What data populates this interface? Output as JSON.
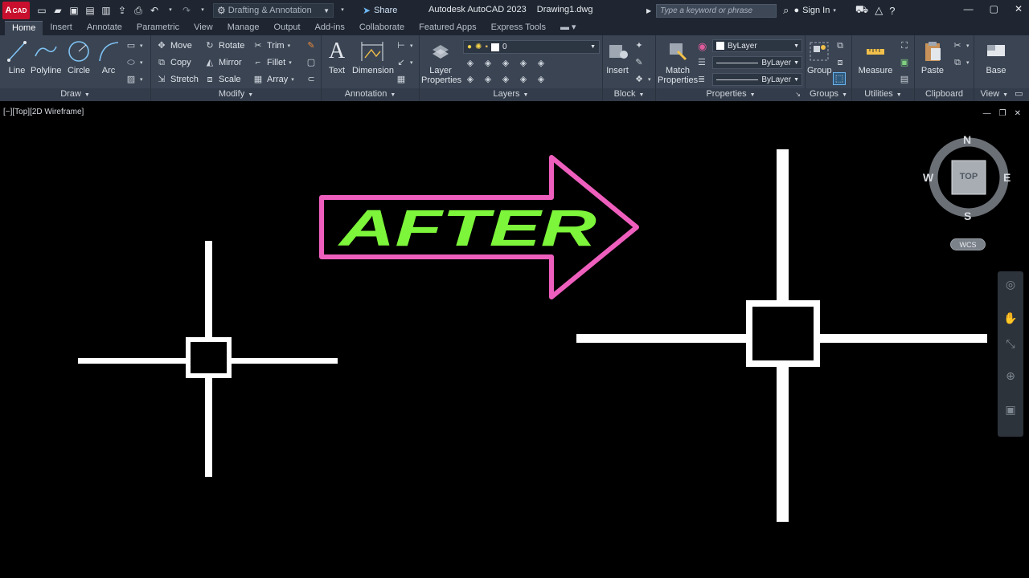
{
  "titlebar": {
    "app_button": "CAD",
    "app_letter": "A",
    "workspace": "Drafting & Annotation",
    "share": "Share",
    "app_name": "Autodesk AutoCAD 2023",
    "document": "Drawing1.dwg",
    "search_placeholder": "Type a keyword or phrase",
    "signin": "Sign In"
  },
  "tabs": [
    "Home",
    "Insert",
    "Annotate",
    "Parametric",
    "View",
    "Manage",
    "Output",
    "Add-ins",
    "Collaborate",
    "Featured Apps",
    "Express Tools"
  ],
  "ribbon": {
    "draw": {
      "title": "Draw",
      "line": "Line",
      "polyline": "Polyline",
      "circle": "Circle",
      "arc": "Arc"
    },
    "modify": {
      "title": "Modify",
      "move": "Move",
      "rotate": "Rotate",
      "trim": "Trim",
      "copy": "Copy",
      "mirror": "Mirror",
      "fillet": "Fillet",
      "stretch": "Stretch",
      "scale": "Scale",
      "array": "Array"
    },
    "annotation": {
      "title": "Annotation",
      "text": "Text",
      "dimension": "Dimension"
    },
    "layers": {
      "title": "Layers",
      "layer_properties_1": "Layer",
      "layer_properties_2": "Properties",
      "current_layer": "0"
    },
    "block": {
      "title": "Block",
      "insert": "Insert"
    },
    "properties": {
      "title": "Properties",
      "match_1": "Match",
      "match_2": "Properties",
      "color": "ByLayer",
      "linetype": "ByLayer",
      "lineweight": "ByLayer"
    },
    "groups": {
      "title": "Groups",
      "group": "Group"
    },
    "utilities": {
      "title": "Utilities",
      "measure": "Measure"
    },
    "clipboard": {
      "title": "Clipboard",
      "paste": "Paste"
    },
    "view": {
      "title": "View",
      "base": "Base"
    }
  },
  "viewport": {
    "label": "[−][Top][2D Wireframe]",
    "overlay_text": "AFTER"
  },
  "viewcube": {
    "top": "TOP",
    "n": "N",
    "s": "S",
    "e": "E",
    "w": "W",
    "wcs": "WCS"
  },
  "colors": {
    "arrow_outline": "#ee5fbd",
    "overlay_text": "#7cf53a",
    "ribbon_bg": "#3a4453",
    "titlebar_bg": "#1f2631",
    "app_button": "#c8102e"
  }
}
